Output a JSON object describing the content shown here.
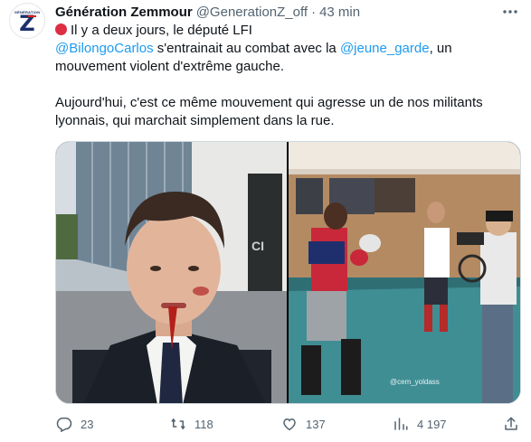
{
  "author": {
    "name": "Génération Zemmour",
    "handle": "@GenerationZ_off",
    "separator": "·",
    "time": "43 min",
    "avatar_small_text": "GÉNÉRATION",
    "avatar_letter": "Z"
  },
  "tweet": {
    "line1_text": "Il y a deux jours, le député LFI",
    "mention1": "@BilongoCarlos",
    "line2_mid": " s'entrainait au combat avec la ",
    "mention2": "@jeune_garde",
    "line2_end": ", un",
    "line3": "mouvement violent d'extrême gauche.",
    "line4": "Aujourd'hui, c'est ce même mouvement qui agresse un de nos militants",
    "line5": "lyonnais, qui marchait simplement dans la rue."
  },
  "media": {
    "right_watermark": "@cem_yoldass"
  },
  "actions": {
    "replies": "23",
    "retweets": "118",
    "likes": "137",
    "views": "4 197"
  },
  "colors": {
    "text": "#0f1419",
    "secondary": "#536471",
    "link": "#1d9bf0",
    "border": "#cfd9de",
    "emoji_red": "#dd2e44"
  },
  "icons": {
    "more": "more-horizontal-icon",
    "reply": "reply-icon",
    "retweet": "retweet-icon",
    "like": "heart-icon",
    "views": "views-chart-icon",
    "share": "share-icon",
    "emoji": "red-circle-emoji"
  }
}
